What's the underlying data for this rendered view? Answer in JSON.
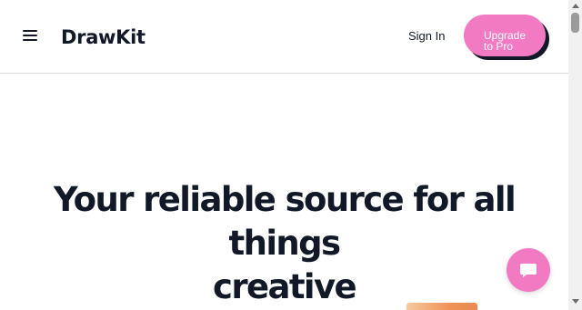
{
  "header": {
    "logo_text": "DrawKit",
    "signin_label": "Sign In",
    "upgrade_label_line1": "Upgrade",
    "upgrade_label_line2": "to Pro"
  },
  "hero": {
    "title_line1": "Your reliable source for all things",
    "title_line2": "creative"
  },
  "icons": {
    "menu": "hamburger-menu-icon",
    "chat": "chat-bubble-icon"
  },
  "colors": {
    "accent_pink": "#f27ac3",
    "text_dark": "#111827",
    "divider": "#d9d9d9"
  }
}
